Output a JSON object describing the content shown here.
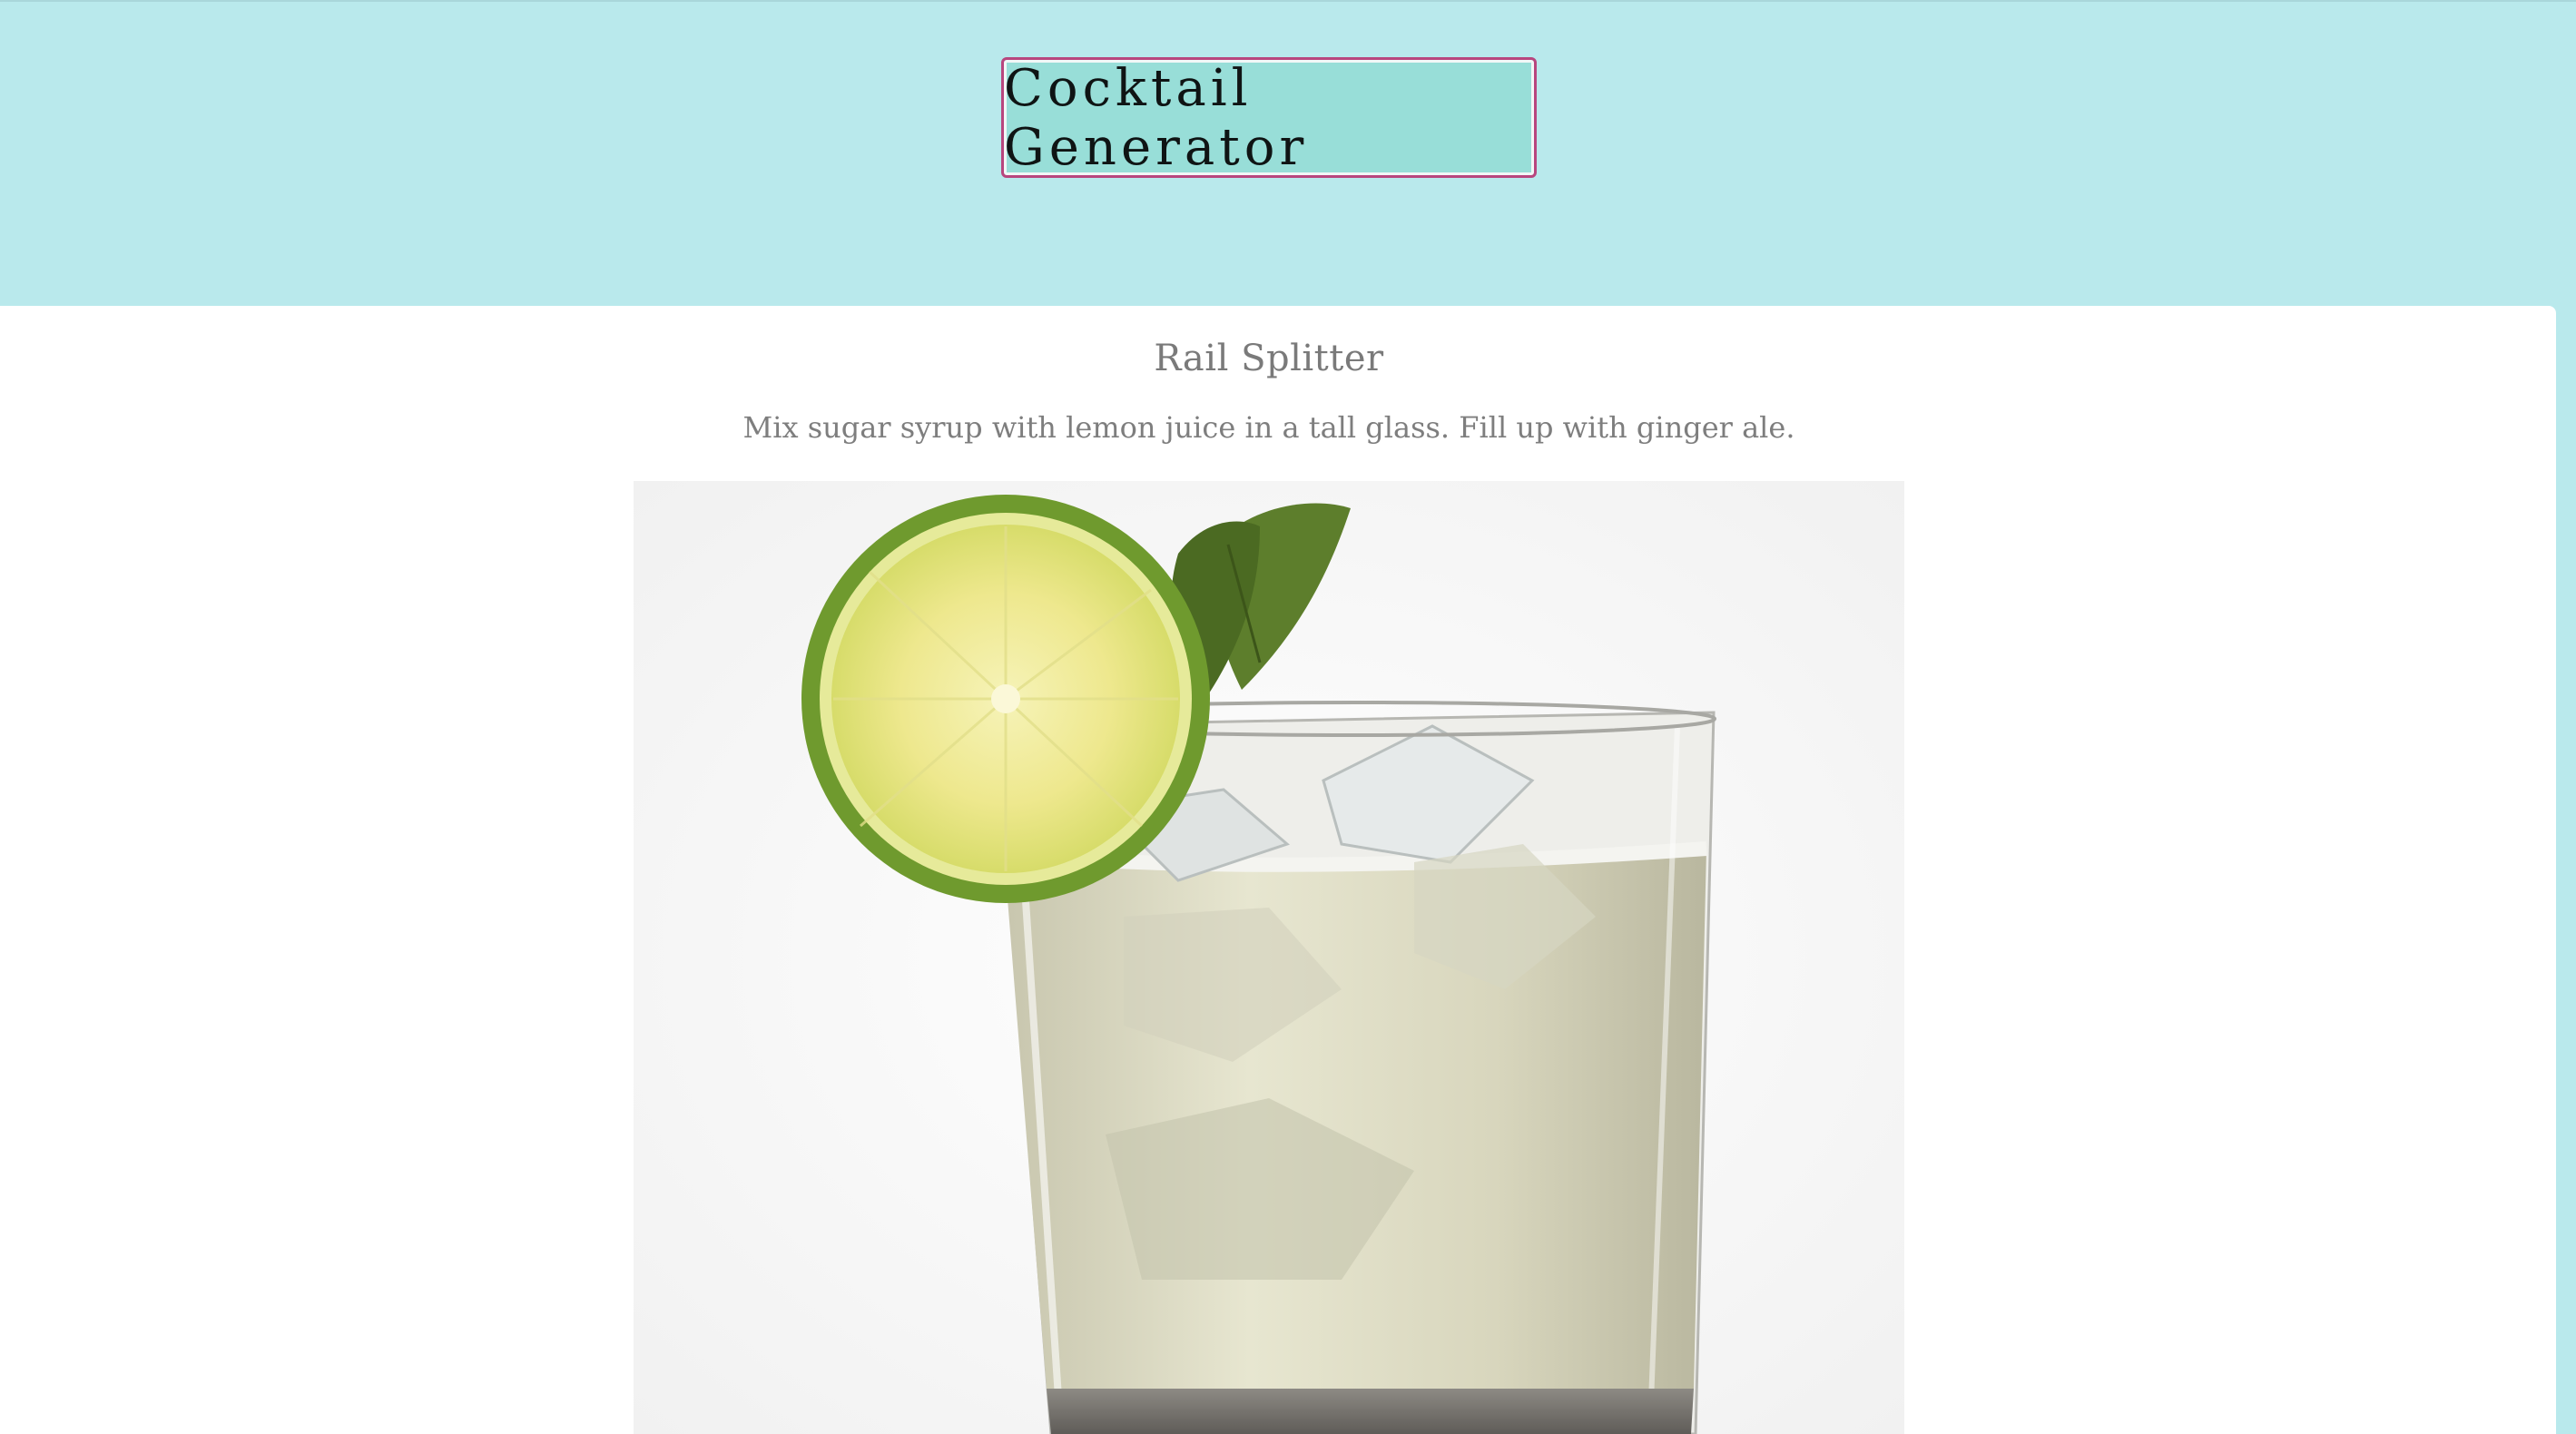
{
  "header": {
    "generate_label": "Cocktail Generator"
  },
  "drink": {
    "name": "Rail Splitter",
    "instructions": "Mix sugar syrup with lemon juice in a tall glass. Fill up with ginger ale."
  },
  "colors": {
    "header_bg": "#b9e9ec",
    "button_bg": "#98ded8",
    "button_border": "#b8467e",
    "card_bg": "#ffffff",
    "text_gray": "#7a7a7a"
  }
}
